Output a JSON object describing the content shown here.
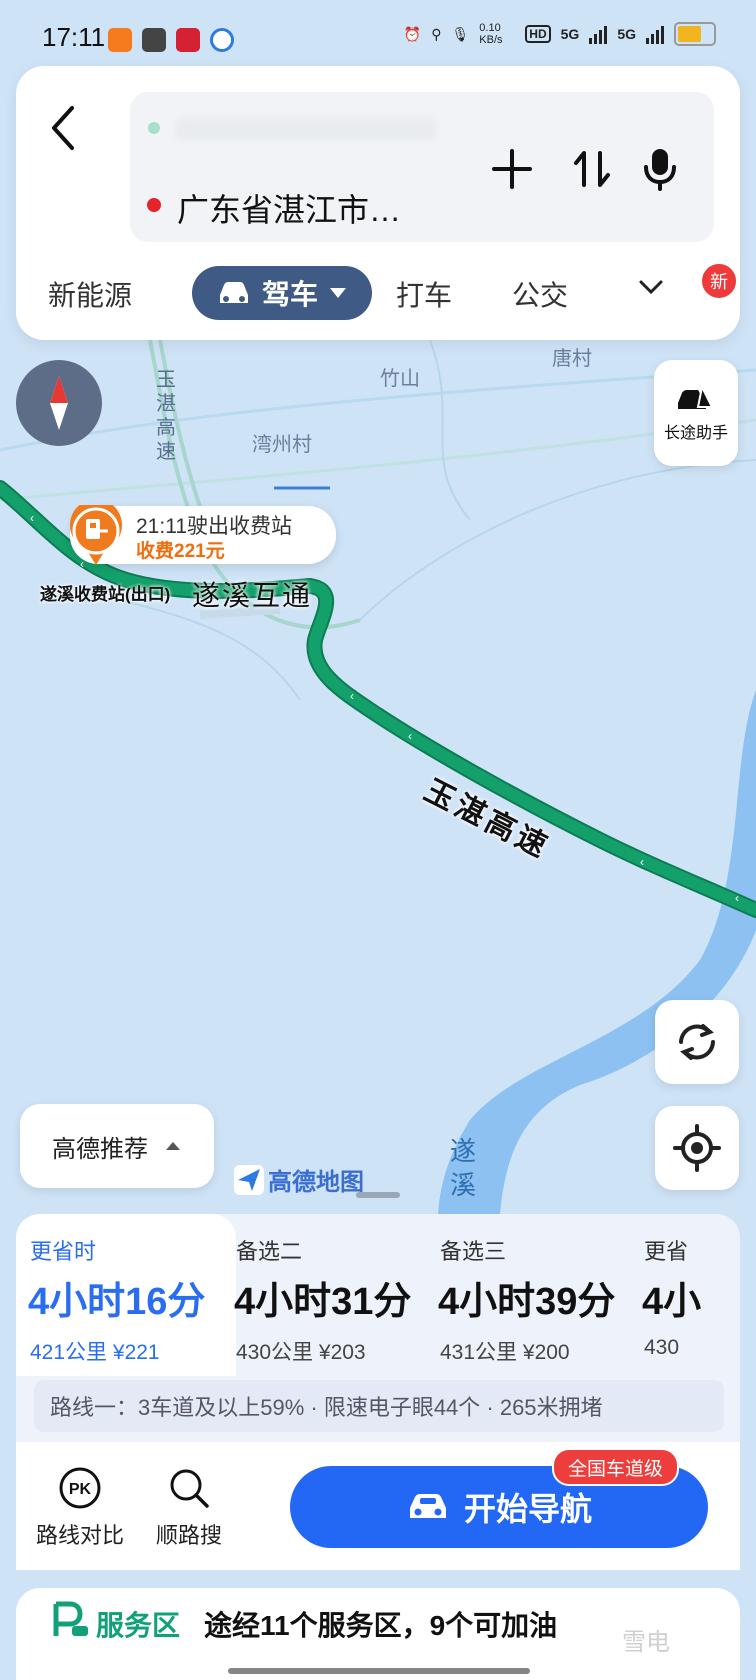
{
  "status_bar": {
    "time": "17:11",
    "speed": "0.10 KB/s",
    "net1": "5G",
    "net2": "5G"
  },
  "search": {
    "destination": "广东省湛江市…"
  },
  "mode_tabs": {
    "new_energy": "新能源",
    "drive": "驾车",
    "taxi": "打车",
    "transit": "公交",
    "new_badge": "新"
  },
  "map": {
    "labels": {
      "zhushan": "竹山",
      "tangcun": "唐村",
      "wanzhou": "湾州村",
      "road_vertical": "玉湛高速",
      "river": "遂溪"
    },
    "toll": {
      "time": "21:11驶出收费站",
      "fee": "收费221元",
      "station": "遂溪收费站(出口)",
      "interchange": "遂溪互通"
    },
    "highway": "玉湛高速",
    "longtrip_label": "长途助手",
    "recommend": "高德推荐",
    "logo": "高德地图"
  },
  "routes": [
    {
      "label": "更省时",
      "time": "4小时16分",
      "distance": "421公里",
      "cost": "¥221"
    },
    {
      "label": "备选二",
      "time": "4小时31分",
      "distance": "430公里",
      "cost": "¥203"
    },
    {
      "label": "备选三",
      "time": "4小时39分",
      "distance": "431公里",
      "cost": "¥200"
    },
    {
      "label": "更省",
      "time": "4小",
      "distance": "430",
      "cost": ""
    }
  ],
  "route_summary": "路线一：3车道及以上59% · 限速电子眼44个 · 265米拥堵",
  "actions": {
    "compare": "路线对比",
    "along_search": "顺路搜",
    "start_nav": "开始导航",
    "lane_badge": "全国车道级",
    "pk_icon_text": "PK"
  },
  "service": {
    "title": "服务区",
    "info": "途经11个服务区，9个可加油",
    "watermark": "雪电"
  },
  "colors": {
    "route_green": "#14a06b",
    "primary_blue": "#2368f5",
    "accent_orange": "#f06d0d",
    "water": "#8cc1f2"
  }
}
